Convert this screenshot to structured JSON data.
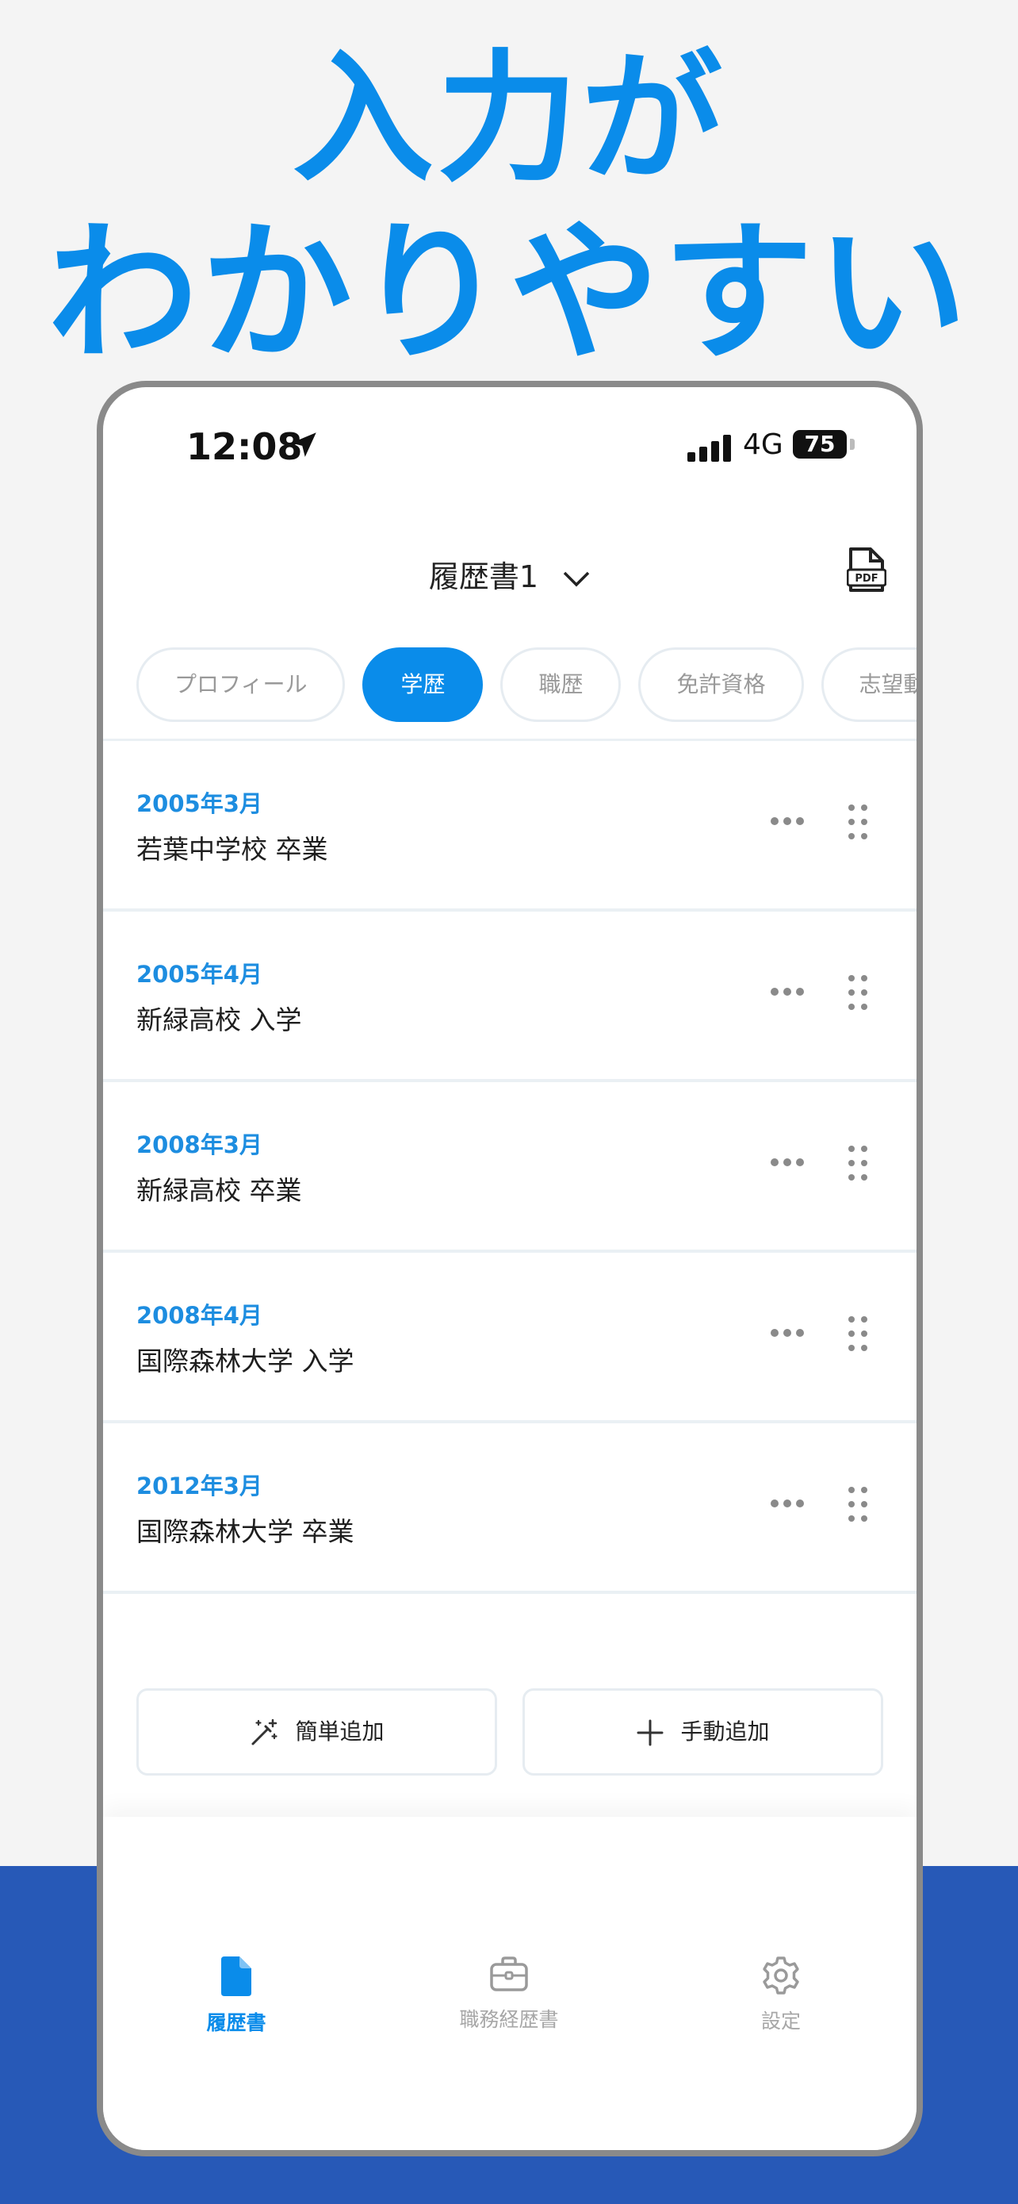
{
  "promo": {
    "line1": "入力が",
    "line2": "わかりやすい"
  },
  "status_bar": {
    "time": "12:08",
    "network": "4G",
    "battery": "75"
  },
  "header": {
    "title": "履歴書1"
  },
  "tabs": [
    "プロフィール",
    "学歴",
    "職歴",
    "免許資格",
    "志望動"
  ],
  "active_tab": "学歴",
  "entries": [
    {
      "date": "2005年3月",
      "text": "若葉中学校 卒業"
    },
    {
      "date": "2005年4月",
      "text": "新緑高校 入学"
    },
    {
      "date": "2008年3月",
      "text": "新緑高校 卒業"
    },
    {
      "date": "2008年4月",
      "text": "国際森林大学 入学"
    },
    {
      "date": "2012年3月",
      "text": "国際森林大学 卒業"
    }
  ],
  "actions": {
    "easy_add": "簡単追加",
    "manual_add": "手動追加"
  },
  "tab_bar": [
    {
      "label": "履歴書",
      "icon": "document-icon",
      "active": true
    },
    {
      "label": "職務経歴書",
      "icon": "briefcase-icon",
      "active": false
    },
    {
      "label": "設定",
      "icon": "gear-icon",
      "active": false
    }
  ],
  "colors": {
    "accent": "#0a8cea",
    "band": "#2759b7",
    "date": "#1d8de0"
  }
}
